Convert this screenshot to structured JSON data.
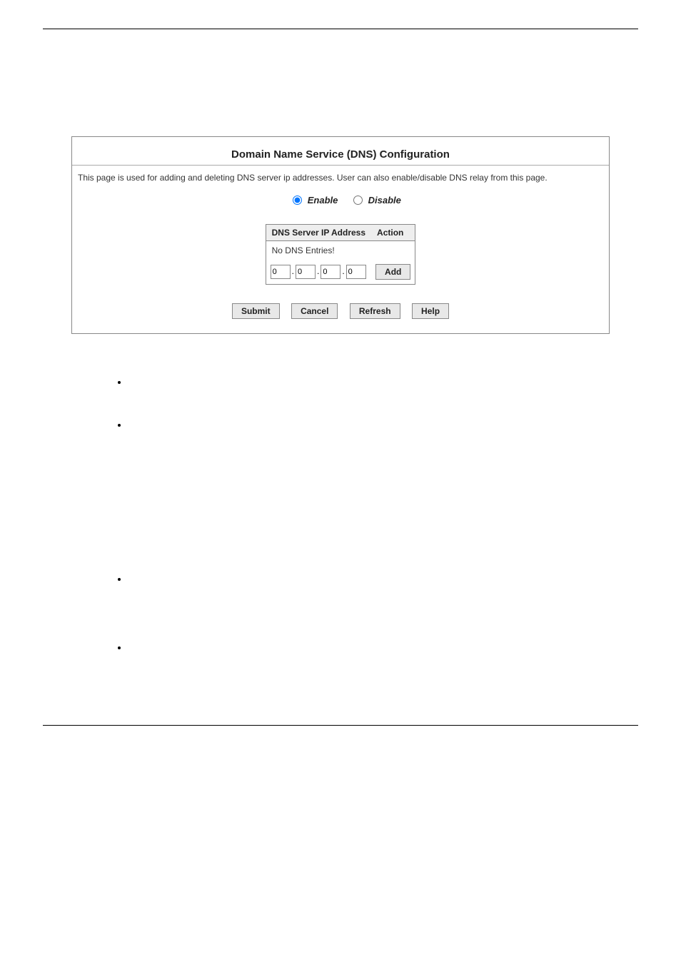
{
  "panel": {
    "title": "Domain Name Service (DNS) Configuration",
    "description": "This page is used for adding and deleting DNS server ip addresses. User can also enable/disable DNS relay from this page.",
    "radio": {
      "enable": "Enable",
      "disable": "Disable"
    },
    "table": {
      "header_ip": "DNS Server IP Address",
      "header_action": "Action",
      "empty_msg": "No DNS Entries!",
      "ip_octets": [
        "0",
        "0",
        "0",
        "0"
      ],
      "add_label": "Add"
    },
    "buttons": {
      "submit": "Submit",
      "cancel": "Cancel",
      "refresh": "Refresh",
      "help": "Help"
    }
  },
  "bullets": [
    "",
    "",
    "",
    ""
  ]
}
